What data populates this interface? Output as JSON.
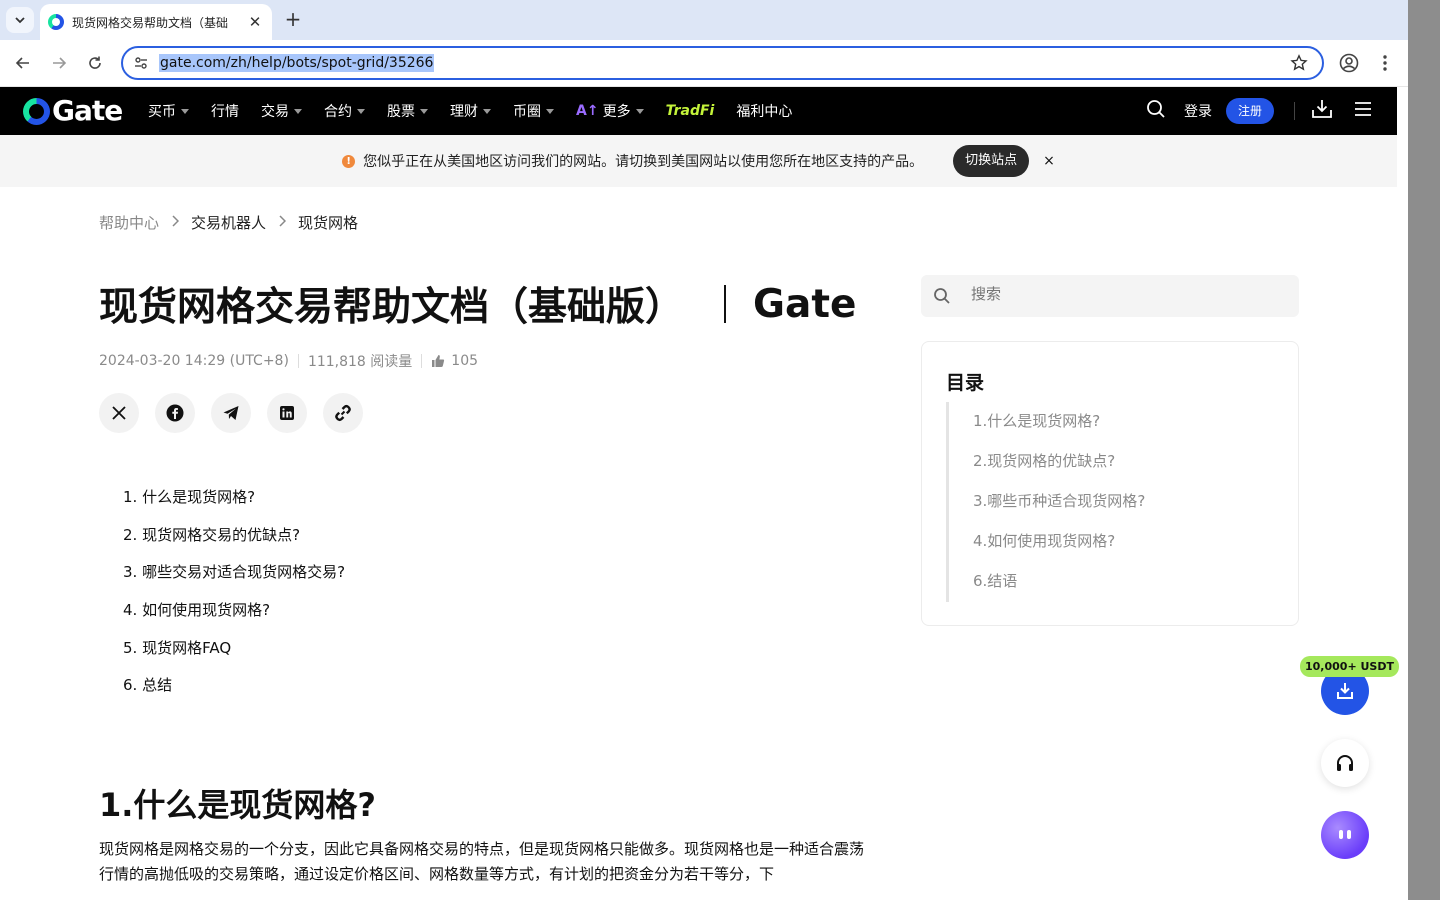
{
  "browser": {
    "tab_title": "现货网格交易帮助文档（基础",
    "url": "gate.com/zh/help/bots/spot-grid/35266"
  },
  "header": {
    "logo_text": "Gate",
    "nav": [
      "买币",
      "行情",
      "交易",
      "合约",
      "股票",
      "理财",
      "币圈",
      "更多",
      "TradFi",
      "福利中心"
    ],
    "login": "登录",
    "signup": "注册"
  },
  "banner": {
    "text": "您似乎正在从美国地区访问我们的网站。请切换到美国网站以使用您所在地区支持的产品。",
    "switch_label": "切换站点",
    "close": "×"
  },
  "breadcrumb": [
    "帮助中心",
    "交易机器人",
    "现货网格"
  ],
  "article": {
    "title": "现货网格交易帮助文档（基础版）",
    "title_suffix": "Gate",
    "date": "2024-03-20 14:29 (UTC+8)",
    "views": "111,818 阅读量",
    "likes": "105",
    "toc": [
      "1. 什么是现货网格?",
      "2. 现货网格交易的优缺点?",
      "3. 哪些交易对适合现货网格交易?",
      "4. 如何使用现货网格?",
      "5. 现货网格FAQ",
      "6. 总结"
    ],
    "section1_heading": "1.什么是现货网格?",
    "section1_text": "现货网格是网格交易的一个分支，因此它具备网格交易的特点，但是现货网格只能做多。现货网格也是一种适合震荡行情的高抛低吸的交易策略，通过设定价格区间、网格数量等方式，有计划的把资金分为若干等分，下"
  },
  "sidebar": {
    "search_placeholder": "搜索",
    "toc_title": "目录",
    "toc": [
      "1.什么是现货网格?",
      "2.现货网格的优缺点?",
      "3.哪些币种适合现货网格?",
      "4.如何使用现货网格?",
      "6.结语"
    ]
  },
  "promo_badge": "10,000+ USDT",
  "colors": {
    "brand_blue": "#2354e6",
    "brand_green": "#17e3a0",
    "promo_green": "#a5e85c"
  }
}
